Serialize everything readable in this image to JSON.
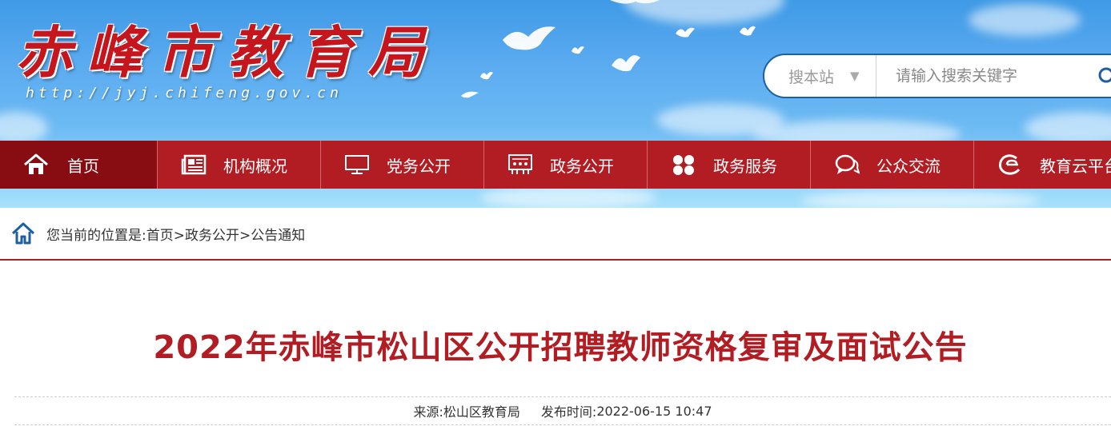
{
  "site": {
    "title": "赤峰市教育局",
    "url": "http://jyj.chifeng.gov.cn"
  },
  "search": {
    "scope_label": "搜本站",
    "placeholder": "请输入搜索关键字"
  },
  "nav": {
    "items": [
      {
        "label": "首页",
        "icon": "home-icon"
      },
      {
        "label": "机构概况",
        "icon": "newspaper-icon"
      },
      {
        "label": "党务公开",
        "icon": "monitor-icon"
      },
      {
        "label": "政务公开",
        "icon": "meeting-icon"
      },
      {
        "label": "政务服务",
        "icon": "grid-icon"
      },
      {
        "label": "公众交流",
        "icon": "chat-icon"
      },
      {
        "label": "教育云平台",
        "icon": "cloud-e-icon"
      }
    ]
  },
  "breadcrumb": {
    "prefix": "您当前的位置是:",
    "items": [
      "首页",
      "政务公开",
      "公告通知"
    ],
    "separator": ">"
  },
  "article": {
    "title": "2022年赤峰市松山区公开招聘教师资格复审及面试公告",
    "source_label": "来源:",
    "source": "松山区教育局",
    "time_label": "发布时间:",
    "time": "2022-06-15 10:47"
  },
  "colors": {
    "brand_red": "#b11d23",
    "nav_active": "#880d12",
    "search_border": "#1d5fa3"
  }
}
